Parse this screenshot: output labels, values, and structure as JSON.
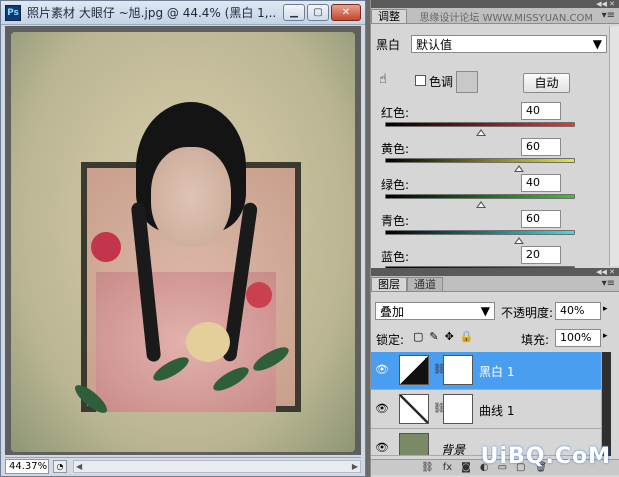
{
  "document": {
    "title": "照片素材 大眼仔 ~旭.jpg @ 44.4% (黑白 1,...",
    "zoom": "44.37%"
  },
  "adjustments": {
    "tab_label": "调整",
    "watermark": "思缘设计论坛 WWW.MISSYUAN.COM",
    "mode_label": "黑白",
    "preset_value": "默认值",
    "tint_label": "色调",
    "auto_label": "自动",
    "sliders": [
      {
        "label": "红色:",
        "value": "40",
        "level_percent": 40
      },
      {
        "label": "黄色:",
        "value": "60",
        "level_percent": 60
      },
      {
        "label": "绿色:",
        "value": "40",
        "level_percent": 40
      },
      {
        "label": "青色:",
        "value": "60",
        "level_percent": 60
      },
      {
        "label": "蓝色:",
        "value": "20",
        "level_percent": 20
      }
    ]
  },
  "layers": {
    "tabs": [
      "图层",
      "通道"
    ],
    "blend_mode": "叠加",
    "opacity_label": "不透明度:",
    "opacity_value": "40%",
    "lock_label": "锁定:",
    "fill_label": "填充:",
    "fill_value": "100%",
    "items": [
      {
        "name": "黑白 1",
        "selected": true
      },
      {
        "name": "曲线 1",
        "selected": false
      },
      {
        "name": "背景",
        "selected": false
      }
    ]
  },
  "branding": {
    "text": "UiBQ.CoM"
  },
  "colors": {
    "selection": "#4a9ef0",
    "panel": "#d6d6d6"
  }
}
